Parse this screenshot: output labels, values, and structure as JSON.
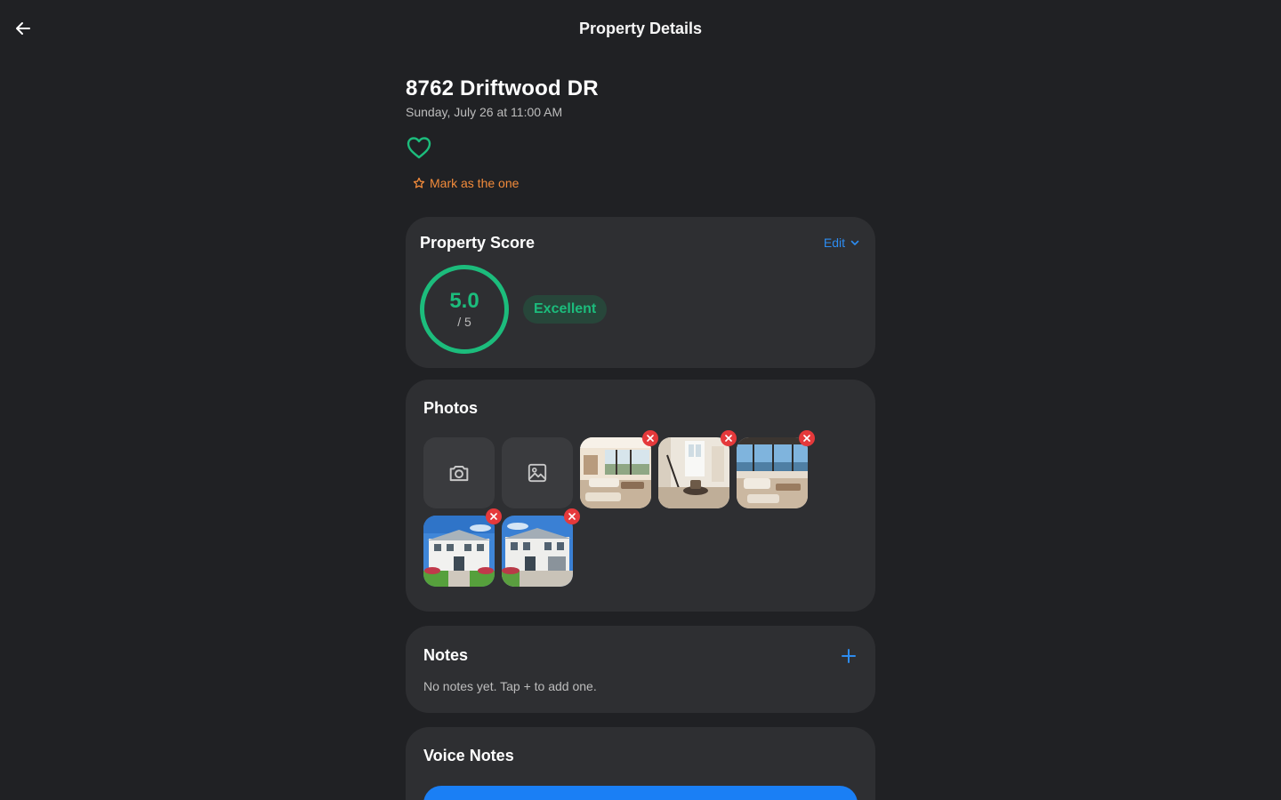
{
  "header": {
    "title": "Property Details",
    "back_icon": "arrow-left-icon"
  },
  "property": {
    "address": "8762 Driftwood DR",
    "datetime": "Sunday, July 26 at 11:00 AM",
    "mark_label": "Mark as the one"
  },
  "score": {
    "title": "Property Score",
    "edit_label": "Edit",
    "value": "5.0",
    "max": "/ 5",
    "rating": "Excellent"
  },
  "photos": {
    "title": "Photos",
    "items": [
      "living-room",
      "foyer",
      "living-room-pool-view",
      "house-exterior",
      "house-exterior"
    ]
  },
  "notes": {
    "title": "Notes",
    "empty_text": "No notes yet. Tap + to add one."
  },
  "voice_notes": {
    "title": "Voice Notes"
  },
  "colors": {
    "background": "#202124",
    "card": "#2e2f32",
    "accent_green": "#1cbc7c",
    "accent_blue": "#2d8cf0",
    "accent_orange": "#f28b3b",
    "danger": "#e5393b"
  }
}
